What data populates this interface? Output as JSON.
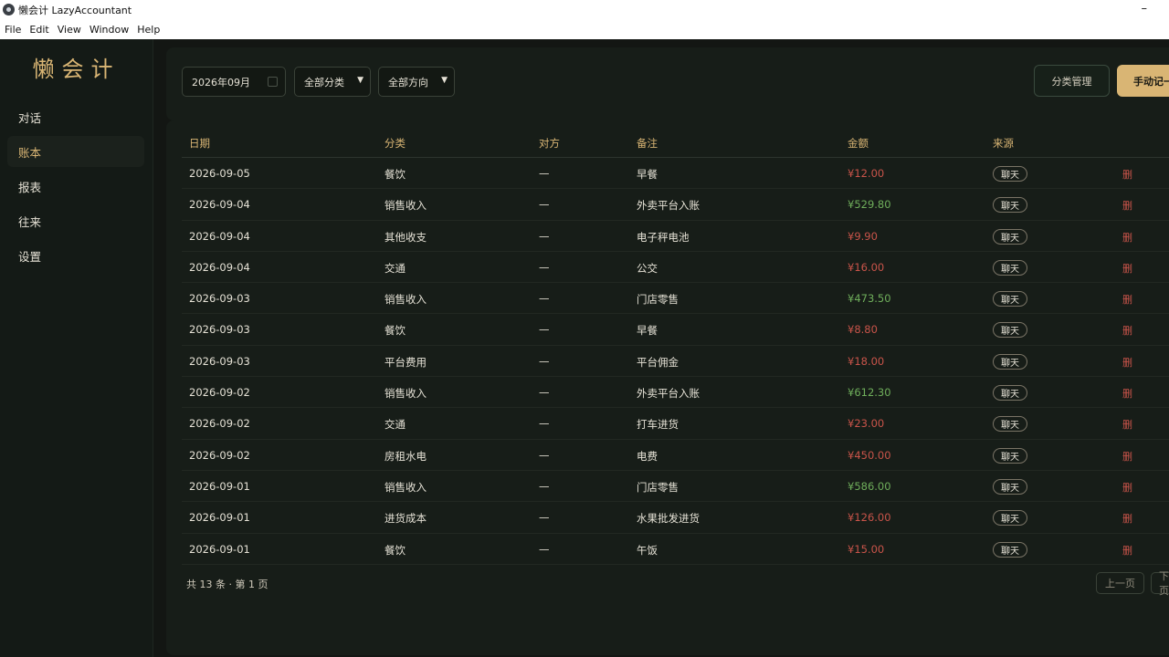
{
  "window": {
    "title": "懒会计 LazyAccountant"
  },
  "menu": [
    "File",
    "Edit",
    "View",
    "Window",
    "Help"
  ],
  "sidebar": {
    "logo": "懒会计",
    "items": [
      {
        "label": "对话"
      },
      {
        "label": "账本",
        "active": true
      },
      {
        "label": "报表"
      },
      {
        "label": "往来"
      },
      {
        "label": "设置"
      }
    ]
  },
  "toolbar": {
    "month": "2026年09月",
    "category_filter": "全部分类",
    "direction_filter": "全部方向",
    "category_manage_label": "分类管理",
    "manual_entry_label": "手动记一笔"
  },
  "table": {
    "headers": {
      "date": "日期",
      "category": "分类",
      "counterparty": "对方",
      "note": "备注",
      "amount": "金额",
      "source": "来源"
    },
    "rows": [
      {
        "date": "2026-09-05",
        "category": "餐饮",
        "counterparty": "—",
        "note": "早餐",
        "amount": "¥12.00",
        "type": "expense",
        "source": "聊天",
        "delete": "删"
      },
      {
        "date": "2026-09-04",
        "category": "销售收入",
        "counterparty": "—",
        "note": "外卖平台入账",
        "amount": "¥529.80",
        "type": "income",
        "source": "聊天",
        "delete": "删"
      },
      {
        "date": "2026-09-04",
        "category": "其他收支",
        "counterparty": "—",
        "note": "电子秤电池",
        "amount": "¥9.90",
        "type": "expense",
        "source": "聊天",
        "delete": "删"
      },
      {
        "date": "2026-09-04",
        "category": "交通",
        "counterparty": "—",
        "note": "公交",
        "amount": "¥16.00",
        "type": "expense",
        "source": "聊天",
        "delete": "删"
      },
      {
        "date": "2026-09-03",
        "category": "销售收入",
        "counterparty": "—",
        "note": "门店零售",
        "amount": "¥473.50",
        "type": "income",
        "source": "聊天",
        "delete": "删"
      },
      {
        "date": "2026-09-03",
        "category": "餐饮",
        "counterparty": "—",
        "note": "早餐",
        "amount": "¥8.80",
        "type": "expense",
        "source": "聊天",
        "delete": "删"
      },
      {
        "date": "2026-09-03",
        "category": "平台费用",
        "counterparty": "—",
        "note": "平台佣金",
        "amount": "¥18.00",
        "type": "expense",
        "source": "聊天",
        "delete": "删"
      },
      {
        "date": "2026-09-02",
        "category": "销售收入",
        "counterparty": "—",
        "note": "外卖平台入账",
        "amount": "¥612.30",
        "type": "income",
        "source": "聊天",
        "delete": "删"
      },
      {
        "date": "2026-09-02",
        "category": "交通",
        "counterparty": "—",
        "note": "打车进货",
        "amount": "¥23.00",
        "type": "expense",
        "source": "聊天",
        "delete": "删"
      },
      {
        "date": "2026-09-02",
        "category": "房租水电",
        "counterparty": "—",
        "note": "电费",
        "amount": "¥450.00",
        "type": "expense",
        "source": "聊天",
        "delete": "删"
      },
      {
        "date": "2026-09-01",
        "category": "销售收入",
        "counterparty": "—",
        "note": "门店零售",
        "amount": "¥586.00",
        "type": "income",
        "source": "聊天",
        "delete": "删"
      },
      {
        "date": "2026-09-01",
        "category": "进货成本",
        "counterparty": "—",
        "note": "水果批发进货",
        "amount": "¥126.00",
        "type": "expense",
        "source": "聊天",
        "delete": "删"
      },
      {
        "date": "2026-09-01",
        "category": "餐饮",
        "counterparty": "—",
        "note": "午饭",
        "amount": "¥15.00",
        "type": "expense",
        "source": "聊天",
        "delete": "删"
      }
    ]
  },
  "pagination": {
    "summary": "共 13 条 · 第 1 页",
    "prev_label": "上一页",
    "next_label": "下一页"
  },
  "colors": {
    "accent": "#d9b574",
    "expense": "#c9544a",
    "income": "#6fae5b",
    "background": "#131613"
  }
}
